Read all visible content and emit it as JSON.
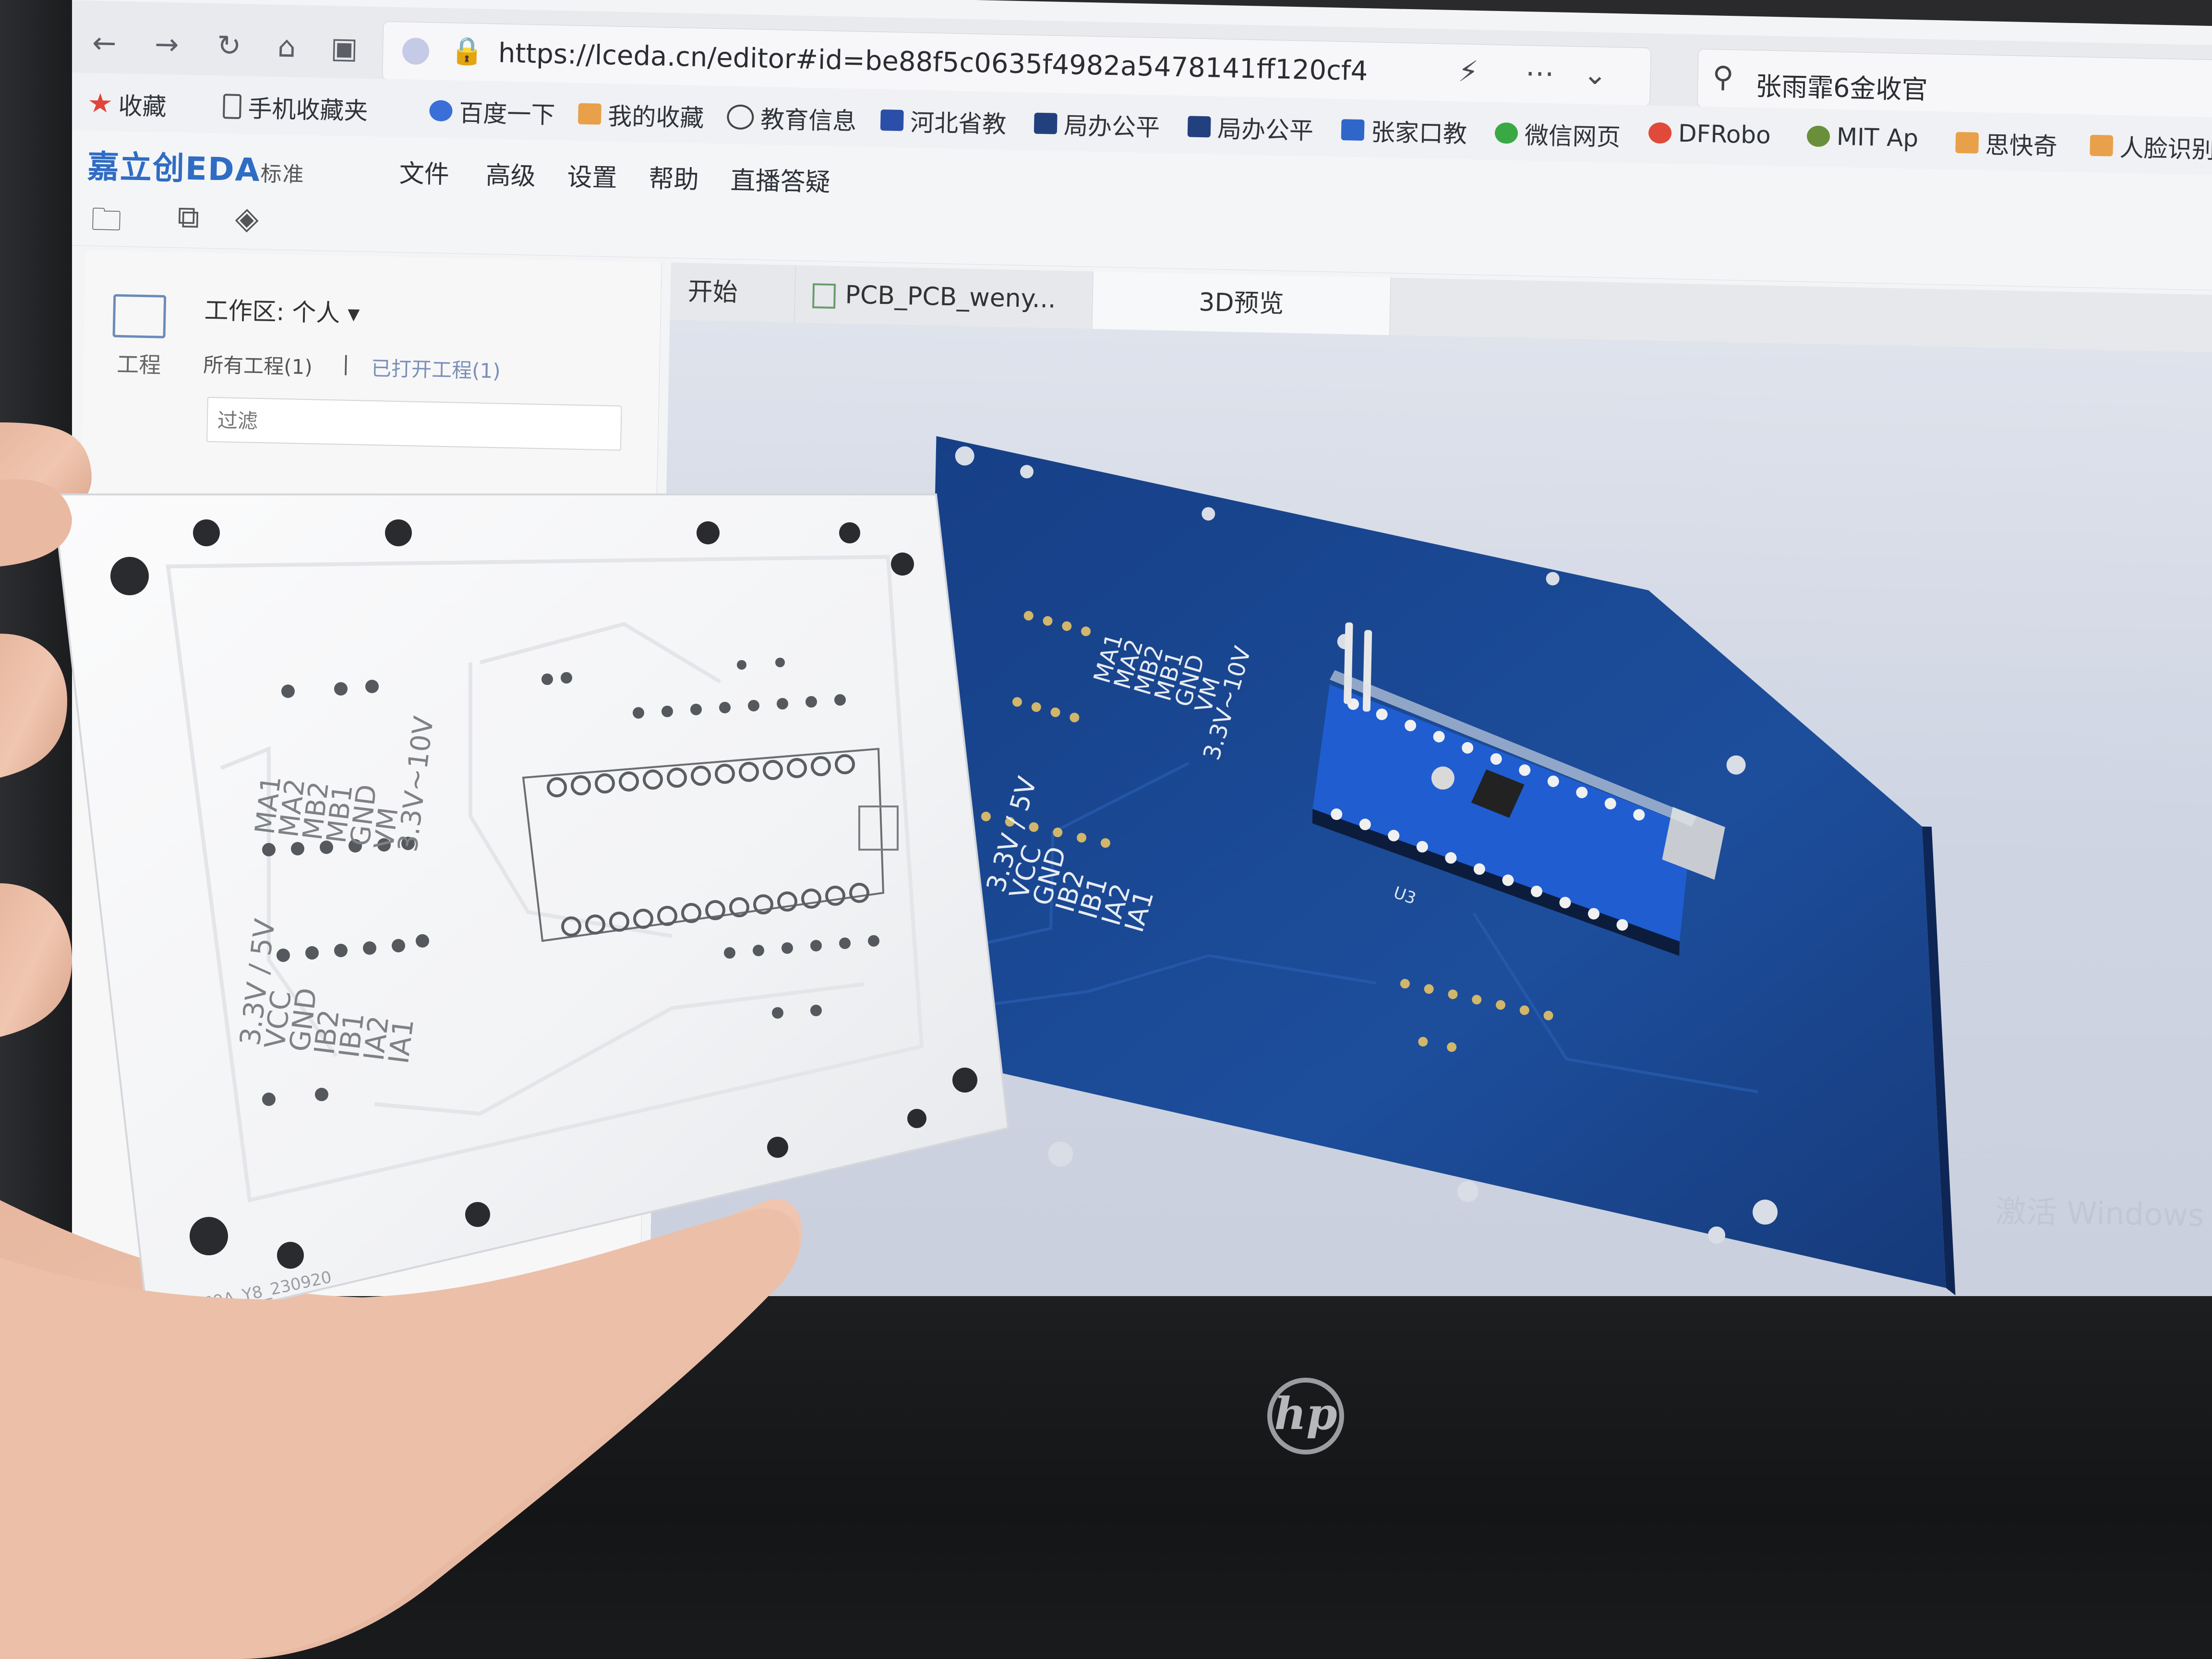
{
  "browser": {
    "url": "https://lceda.cn/editor#id=be88f5c0635f4982a5478141ff120cf4",
    "search_text": "张雨霏6金收官",
    "nav_icons": [
      "back-arrow-icon",
      "forward-arrow-icon",
      "reload-icon",
      "home-icon",
      "briefcase-icon"
    ],
    "bookmarks": [
      "收藏",
      "手机收藏夹",
      "百度一下",
      "我的收藏",
      "教育信息",
      "河北省教",
      "局办公平",
      "局办公平",
      "张家口教",
      "微信网页",
      "DFRobo",
      "MIT Ap",
      "思快奇",
      "人脸识别"
    ]
  },
  "eda": {
    "logo": "嘉立创EDA",
    "edition": "标准",
    "menu": [
      "文件",
      "高级",
      "设置",
      "帮助",
      "直播答疑"
    ],
    "left_panel": {
      "project_label": "工程",
      "workspace": "工作区: 个人",
      "all_projects": "所有工程(1)",
      "separator": "|",
      "open_projects": "已打开工程(1)",
      "filter_placeholder": "过滤"
    },
    "tabs": [
      "开始",
      "PCB_PCB_weny...",
      "3D预览"
    ],
    "board_silkscreen": {
      "group_a": [
        "MA1",
        "MA2",
        "MB2",
        "MB1",
        "GND",
        "VM",
        "3.3V~10V"
      ],
      "group_b": [
        "3.3V / 5V",
        "VCC",
        "GND",
        "IB2",
        "IB1",
        "IA2",
        "IA1"
      ],
      "module_ref": "U3"
    },
    "watermark": "激活 Windows"
  },
  "laptop": {
    "brand": "hp"
  },
  "held_board": {
    "group_a": [
      "MA1",
      "MA2",
      "MB2",
      "MB1",
      "GND",
      "VM",
      "3.3V~10V"
    ],
    "group_b": [
      "3.3V / 5V",
      "VCC",
      "GND",
      "IB2",
      "IB1",
      "IA2",
      "IA1"
    ],
    "order_code": "5430369A_Y8_230920"
  }
}
